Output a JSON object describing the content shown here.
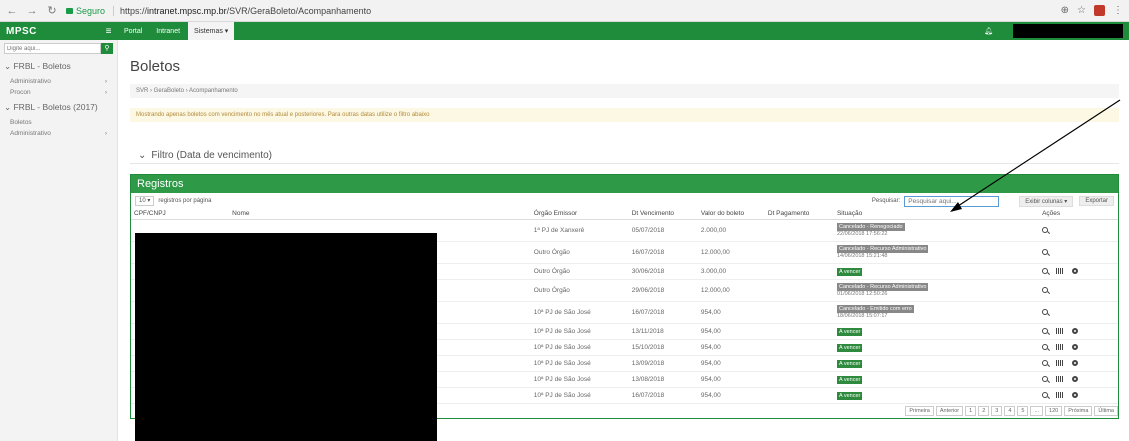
{
  "browser": {
    "secure_label": "Seguro",
    "url_base": "https://",
    "url_host": "intranet.mpsc.mp.br",
    "url_path": "/SVR/GeraBoleto/Acompanhamento"
  },
  "topbar": {
    "logo": "MPSC",
    "nav": [
      "Portal",
      "Intranet",
      "Sistemas ▾"
    ]
  },
  "sidebar": {
    "search_placeholder": "Digite aqui...",
    "groups": [
      {
        "title": "FRBL - Boletos",
        "items": [
          "Administrativo",
          "Procon"
        ]
      },
      {
        "title": "FRBL - Boletos (2017)",
        "items": [
          "Boletos",
          "Administrativo"
        ]
      }
    ]
  },
  "page": {
    "title": "Boletos",
    "breadcrumb": "SVR › GeraBoleto › Acompanhamento",
    "alert": "Mostrando apenas boletos com vencimento no mês atual e posteriores. Para outras datas utilize o filtro abaixo",
    "filter": "Filtro (Data de vencimento)"
  },
  "panel": {
    "title": "Registros",
    "page_size": "10",
    "page_size_label": "registros por página",
    "search_label": "Pesquisar:",
    "search_placeholder": "Pesquisar aqui...",
    "columns_btn": "Exibir colunas",
    "export_btn": "Exportar",
    "columns": [
      "CPF/CNPJ",
      "Nome",
      "Órgão Emissor",
      "Dt Vencimento",
      "Valor do boleto",
      "Dt Pagamento",
      "Situação",
      "Ações"
    ],
    "rows": [
      {
        "orgao": "1ª PJ de Xanxerê",
        "venc": "05/07/2018",
        "valor": "2.000,00",
        "status": "Cancelado - Renegociado",
        "status_date": "22/06/2018 17:56:22",
        "kind": "grey"
      },
      {
        "orgao": "Outro Órgão",
        "venc": "16/07/2018",
        "valor": "12.000,00",
        "status": "Cancelado - Recurso Administrativo",
        "status_date": "14/06/2018 15:21:48",
        "kind": "grey"
      },
      {
        "orgao": "Outro Órgão",
        "venc": "30/06/2018",
        "valor": "3.000,00",
        "status": "A vencer",
        "status_date": "",
        "kind": "green"
      },
      {
        "orgao": "Outro Órgão",
        "venc": "29/06/2018",
        "valor": "12.000,00",
        "status": "Cancelado - Recurso Administrativo",
        "status_date": "01/06/2018 12:50:26",
        "kind": "grey"
      },
      {
        "orgao": "10ª PJ de São José",
        "venc": "16/07/2018",
        "valor": "954,00",
        "status": "Cancelado - Emitido com erro",
        "status_date": "18/06/2018 15:07:17",
        "kind": "grey"
      },
      {
        "orgao": "10ª PJ de São José",
        "venc": "13/11/2018",
        "valor": "954,00",
        "status": "A vencer",
        "status_date": "",
        "kind": "green"
      },
      {
        "orgao": "10ª PJ de São José",
        "venc": "15/10/2018",
        "valor": "954,00",
        "status": "A vencer",
        "status_date": "",
        "kind": "green"
      },
      {
        "orgao": "10ª PJ de São José",
        "venc": "13/09/2018",
        "valor": "954,00",
        "status": "A vencer",
        "status_date": "",
        "kind": "green"
      },
      {
        "orgao": "10ª PJ de São José",
        "venc": "13/08/2018",
        "valor": "954,00",
        "status": "A vencer",
        "status_date": "",
        "kind": "green"
      },
      {
        "orgao": "10ª PJ de São José",
        "venc": "16/07/2018",
        "valor": "954,00",
        "status": "A vencer",
        "status_date": "",
        "kind": "green"
      }
    ],
    "pager": [
      "Primeira",
      "Anterior",
      "1",
      "2",
      "3",
      "4",
      "5",
      "...",
      "120",
      "Próxima",
      "Última"
    ]
  }
}
